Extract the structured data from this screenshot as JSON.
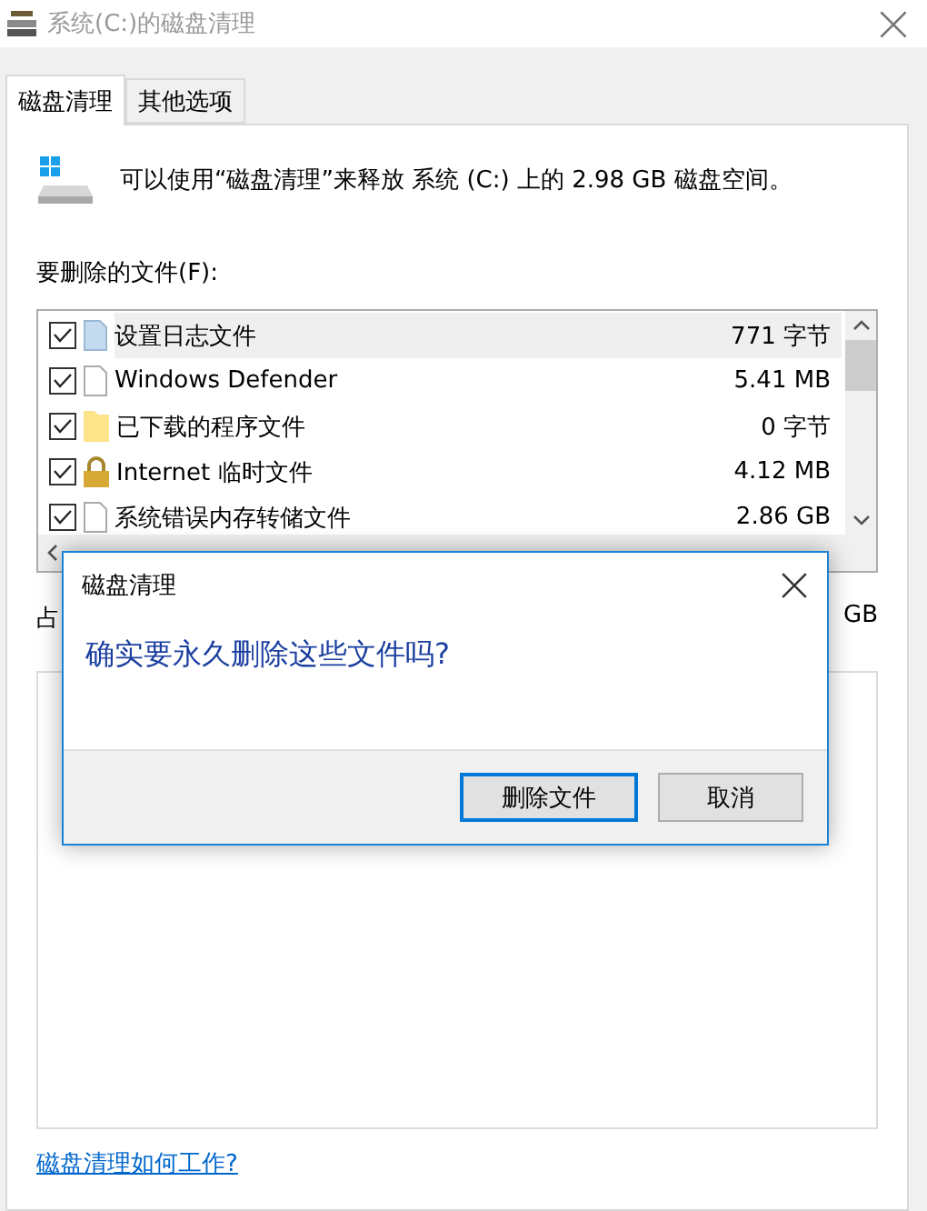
{
  "window": {
    "title": "系统(C:)的磁盘清理"
  },
  "tabs": [
    {
      "label": "磁盘清理",
      "selected": true
    },
    {
      "label": "其他选项",
      "selected": false
    }
  ],
  "intro": "可以使用“磁盘清理”来释放 系统 (C:) 上的 2.98 GB 磁盘空间。",
  "files_label": "要删除的文件(F):",
  "files": [
    {
      "name": "设置日志文件",
      "size": "771 字节",
      "checked": true,
      "selected": true,
      "kind": "log"
    },
    {
      "name": "Windows Defender",
      "size": "5.41 MB",
      "checked": true,
      "selected": false,
      "kind": "page"
    },
    {
      "name": "已下载的程序文件",
      "size": "0 字节",
      "checked": true,
      "selected": false,
      "kind": "folder"
    },
    {
      "name": "Internet 临时文件",
      "size": "4.12 MB",
      "checked": true,
      "selected": false,
      "kind": "lock"
    },
    {
      "name": "系统错误内存转储文件",
      "size": "2.86 GB",
      "checked": true,
      "selected": false,
      "kind": "page"
    }
  ],
  "total": {
    "label": "占",
    "value": "GB"
  },
  "help_link": "磁盘清理如何工作?",
  "dialog": {
    "title": "磁盘清理",
    "message": "确实要永久删除这些文件吗?",
    "buttons": [
      {
        "label": "删除文件",
        "selected": true
      },
      {
        "label": "取消",
        "selected": false
      }
    ]
  }
}
